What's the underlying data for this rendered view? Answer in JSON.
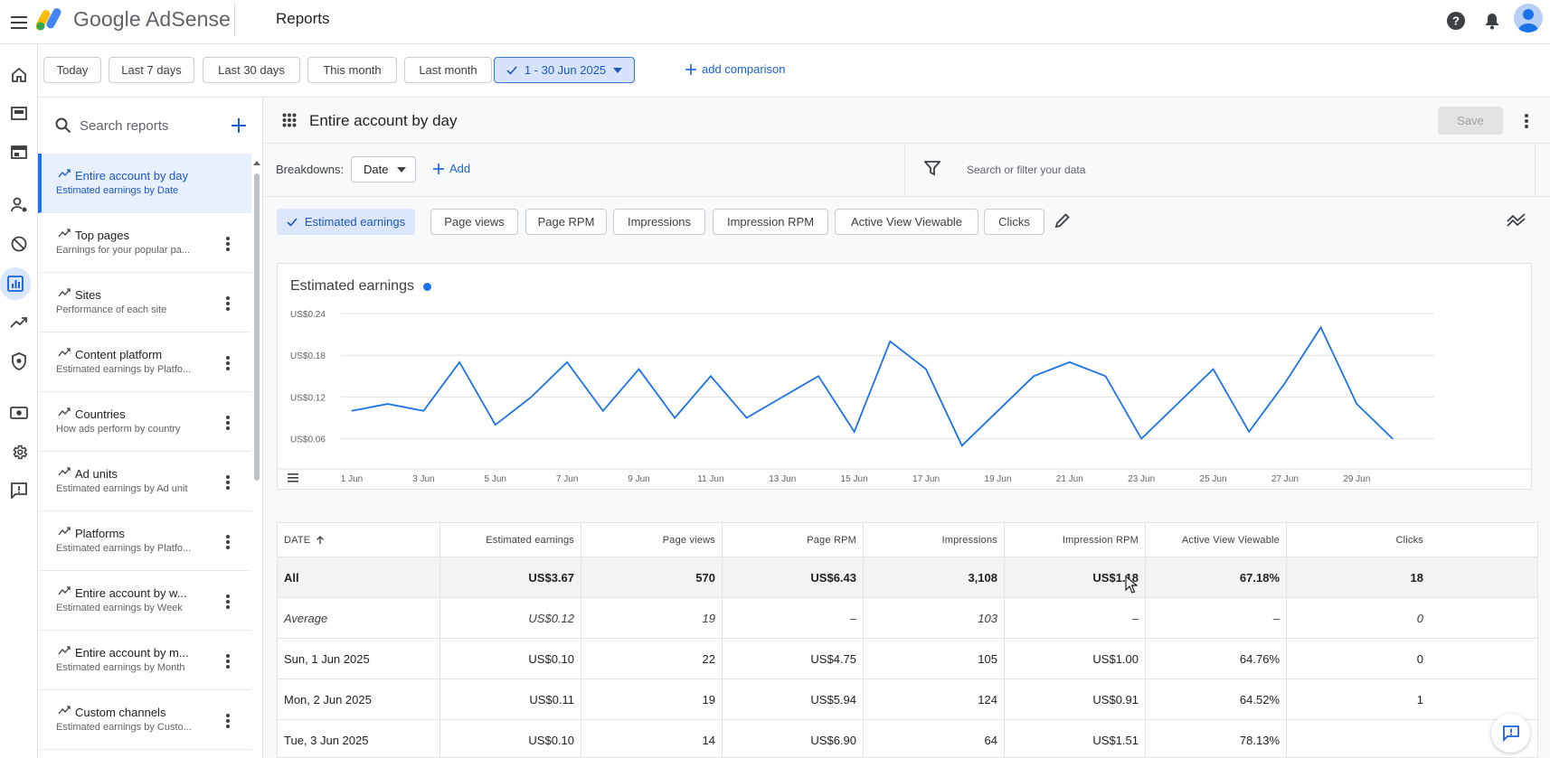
{
  "app": {
    "brand": "Google AdSense",
    "page_title": "Reports"
  },
  "colors": {
    "accent": "#1a73e8",
    "selected_chip_bg": "#d6e3fb"
  },
  "date_filters": {
    "items": [
      "Today",
      "Last 7 days",
      "Last 30 days",
      "This month",
      "Last month"
    ],
    "selected": "1 - 30 Jun 2025",
    "add_comparison": "add comparison"
  },
  "sidebar": {
    "search_placeholder": "Search reports",
    "items": [
      {
        "title": "Entire account by day",
        "subtitle": "Estimated earnings by Date"
      },
      {
        "title": "Top pages",
        "subtitle": "Earnings for your popular pa..."
      },
      {
        "title": "Sites",
        "subtitle": "Performance of each site"
      },
      {
        "title": "Content platform",
        "subtitle": "Estimated earnings by Platfo..."
      },
      {
        "title": "Countries",
        "subtitle": "How ads perform by country"
      },
      {
        "title": "Ad units",
        "subtitle": "Estimated earnings by Ad unit"
      },
      {
        "title": "Platforms",
        "subtitle": "Estimated earnings by Platfo..."
      },
      {
        "title": "Entire account by w...",
        "subtitle": "Estimated earnings by Week"
      },
      {
        "title": "Entire account by m...",
        "subtitle": "Estimated earnings by Month"
      },
      {
        "title": "Custom channels",
        "subtitle": "Estimated earnings by Custo..."
      }
    ]
  },
  "report": {
    "title": "Entire account by day",
    "save_label": "Save",
    "breakdowns_label": "Breakdowns:",
    "breakdown_value": "Date",
    "add_label": "Add",
    "filter_placeholder": "Search or filter your data",
    "metrics": [
      "Estimated earnings",
      "Page views",
      "Page RPM",
      "Impressions",
      "Impression RPM",
      "Active View Viewable",
      "Clicks"
    ],
    "selected_metric": "Estimated earnings"
  },
  "chart_data": {
    "type": "line",
    "title": "Estimated earnings",
    "x": [
      "1 Jun",
      "2 Jun",
      "3 Jun",
      "4 Jun",
      "5 Jun",
      "6 Jun",
      "7 Jun",
      "8 Jun",
      "9 Jun",
      "10 Jun",
      "11 Jun",
      "12 Jun",
      "13 Jun",
      "14 Jun",
      "15 Jun",
      "16 Jun",
      "17 Jun",
      "18 Jun",
      "19 Jun",
      "20 Jun",
      "21 Jun",
      "22 Jun",
      "23 Jun",
      "24 Jun",
      "25 Jun",
      "26 Jun",
      "27 Jun",
      "28 Jun",
      "29 Jun",
      "30 Jun"
    ],
    "x_tick_labels": [
      "1 Jun",
      "3 Jun",
      "5 Jun",
      "7 Jun",
      "9 Jun",
      "11 Jun",
      "13 Jun",
      "15 Jun",
      "17 Jun",
      "19 Jun",
      "21 Jun",
      "23 Jun",
      "25 Jun",
      "27 Jun",
      "29 Jun"
    ],
    "series": [
      {
        "name": "Estimated earnings",
        "color": "#1a73e8",
        "values": [
          0.1,
          0.11,
          0.1,
          0.17,
          0.08,
          0.12,
          0.17,
          0.1,
          0.16,
          0.09,
          0.15,
          0.09,
          0.12,
          0.15,
          0.07,
          0.2,
          0.16,
          0.05,
          0.1,
          0.15,
          0.17,
          0.15,
          0.06,
          0.11,
          0.16,
          0.07,
          0.14,
          0.22,
          0.11,
          0.06
        ]
      }
    ],
    "y_tick_labels": [
      "US$0.06",
      "US$0.12",
      "US$0.18",
      "US$0.24"
    ],
    "y_ticks": [
      0.06,
      0.12,
      0.18,
      0.24
    ],
    "ylim": [
      0.04,
      0.24
    ]
  },
  "table": {
    "headers": [
      "DATE",
      "Estimated earnings",
      "Page views",
      "Page RPM",
      "Impressions",
      "Impression RPM",
      "Active View Viewable",
      "Clicks"
    ],
    "rows": [
      [
        "All",
        "US$3.67",
        "570",
        "US$6.43",
        "3,108",
        "US$1.18",
        "67.18%",
        "18"
      ],
      [
        "Average",
        "US$0.12",
        "19",
        "–",
        "103",
        "–",
        "–",
        "0"
      ],
      [
        "Sun, 1 Jun 2025",
        "US$0.10",
        "22",
        "US$4.75",
        "105",
        "US$1.00",
        "64.76%",
        "0"
      ],
      [
        "Mon, 2 Jun 2025",
        "US$0.11",
        "19",
        "US$5.94",
        "124",
        "US$0.91",
        "64.52%",
        "1"
      ],
      [
        "Tue, 3 Jun 2025",
        "US$0.10",
        "14",
        "US$6.90",
        "64",
        "US$1.51",
        "78.13%",
        ""
      ]
    ]
  }
}
